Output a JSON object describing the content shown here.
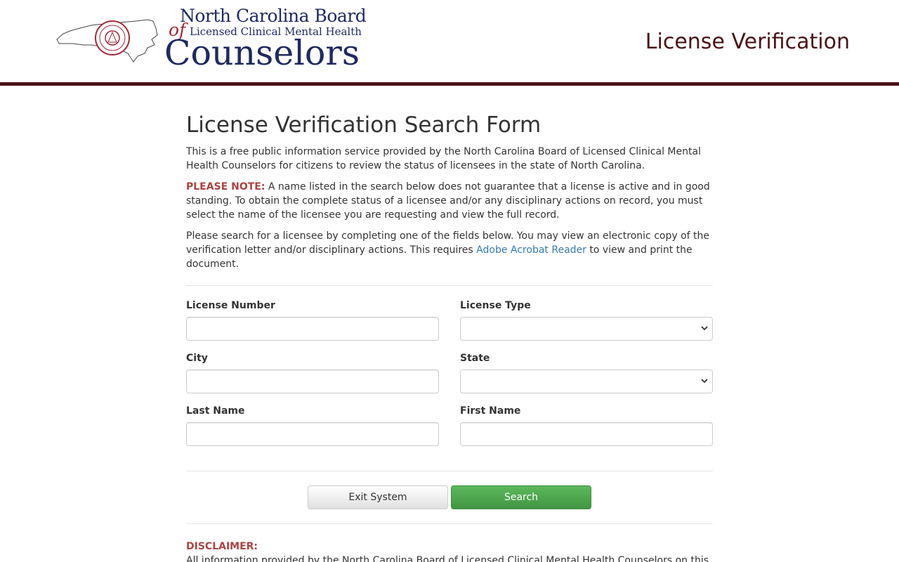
{
  "header": {
    "logo": {
      "line1": "North Carolina Board",
      "of": "of",
      "line2": "Licensed Clinical Mental Health",
      "line3": "Counselors"
    },
    "title": "License Verification"
  },
  "main": {
    "title": "License Verification Search Form",
    "intro": "This is a free public information service provided by the North Carolina Board of Licensed Clinical Mental Health Counselors for citizens to review the status of licensees in the state of North Carolina.",
    "note_label": "PLEASE NOTE:",
    "note_text": " A name listed in the search below does not guarantee that a license is active and in good standing. To obtain the complete status of a licensee and/or any disciplinary actions on record, you must select the name of the licensee you are requesting and view the full record.",
    "search_text_before": "Please search for a licensee by completing one of the fields below. You may view an electronic copy of the verification letter and/or disciplinary actions. This requires ",
    "search_link": "Adobe Acrobat Reader",
    "search_text_after": " to view and print the document."
  },
  "form": {
    "license_number": {
      "label": "License Number",
      "value": ""
    },
    "license_type": {
      "label": "License Type",
      "selected": ""
    },
    "city": {
      "label": "City",
      "value": ""
    },
    "state": {
      "label": "State",
      "selected": ""
    },
    "last_name": {
      "label": "Last Name",
      "value": ""
    },
    "first_name": {
      "label": "First Name",
      "value": ""
    }
  },
  "buttons": {
    "exit": "Exit System",
    "search": "Search"
  },
  "disclaimer": {
    "label": "DISCLAIMER:",
    "text": "All information provided by the North Carolina Board of Licensed Clinical Mental Health Counselors on this"
  },
  "colors": {
    "header_rule": "#4a1416",
    "logo_blue": "#1f2a63",
    "logo_red": "#a02a36",
    "note_red": "#a94442",
    "link_blue": "#337ab7",
    "search_green": "#5cb85c"
  }
}
